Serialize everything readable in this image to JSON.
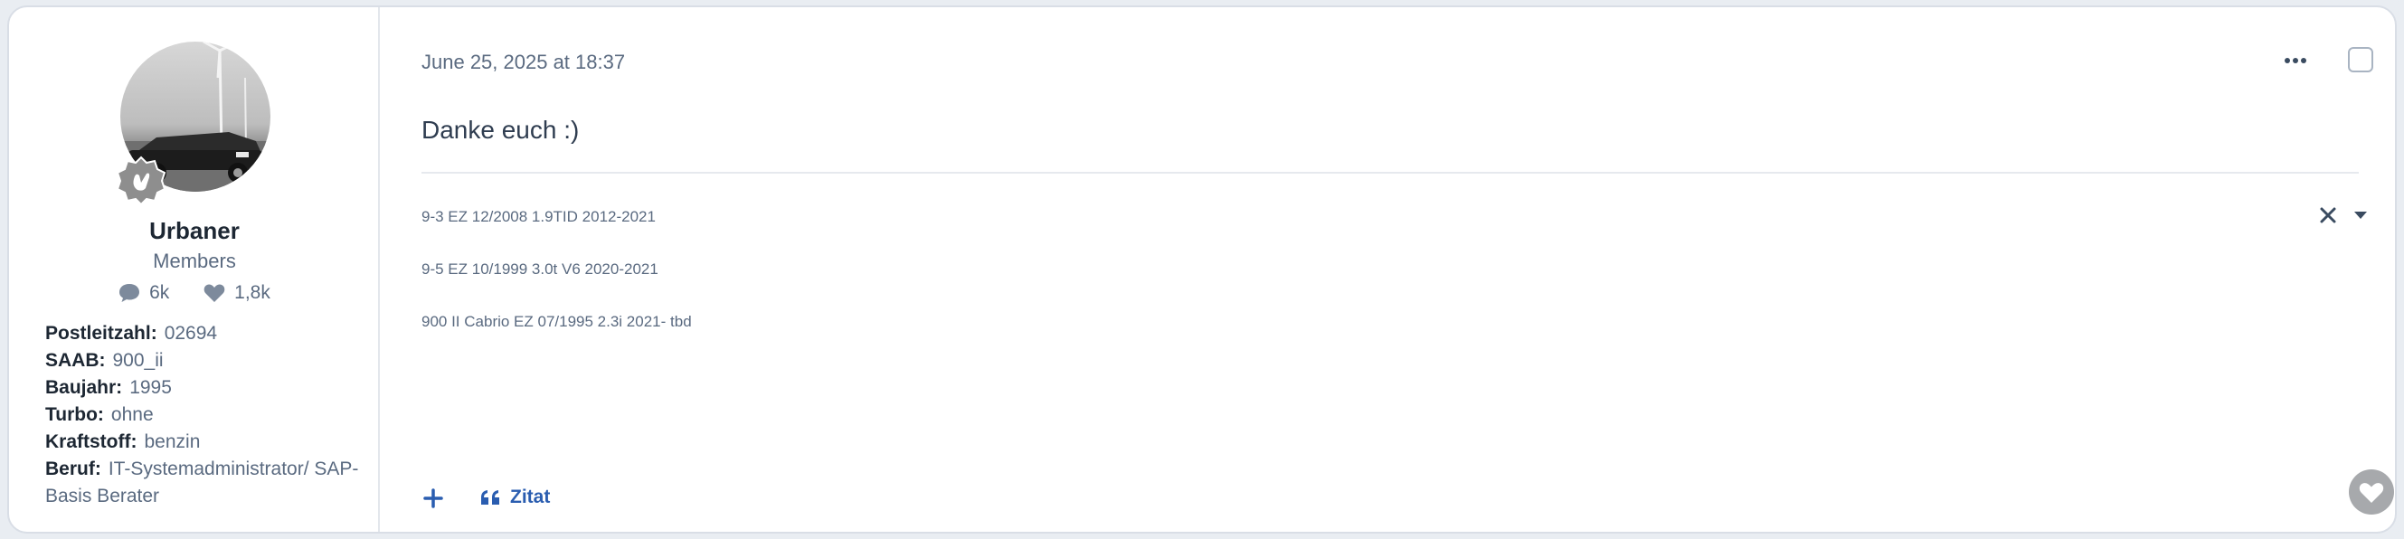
{
  "author": {
    "username": "Urbaner",
    "usergroup": "Members",
    "stats": {
      "posts": "6k",
      "likes": "1,8k"
    },
    "fields": [
      {
        "label": "Postleitzahl:",
        "value": "02694"
      },
      {
        "label": "SAAB:",
        "value": "900_ii"
      },
      {
        "label": "Baujahr:",
        "value": "1995"
      },
      {
        "label": "Turbo:",
        "value": "ohne"
      },
      {
        "label": "Kraftstoff:",
        "value": "benzin"
      },
      {
        "label": "Beruf:",
        "value": "IT-Systemadministrator/ SAP-Basis Berater"
      }
    ]
  },
  "post": {
    "date": "June 25, 2025 at 18:37",
    "message": "Danke euch :)",
    "signature": [
      "9-3 EZ 12/2008 1.9TID 2012-2021",
      "9-5 EZ 10/1999 3.0t V6 2020-2021",
      "900 II Cabrio EZ 07/1995 2.3i 2021- tbd"
    ],
    "quote_label": "Zitat"
  },
  "icons": {
    "posts": "comment-icon",
    "likes": "heart-icon",
    "more": "ellipsis-icon",
    "close": "close-icon",
    "caret": "caret-down-icon",
    "add": "plus-icon",
    "quote": "quote-icon",
    "like": "like-heart-icon"
  },
  "colors": {
    "accent": "#2a5db0",
    "text": "#3a4b60",
    "muted": "#5a6a80"
  }
}
